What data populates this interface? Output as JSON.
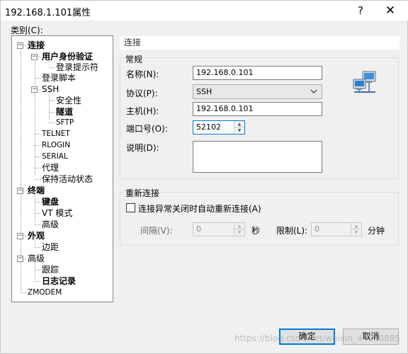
{
  "window": {
    "title": "192.168.1.101属性",
    "help_glyph": "?",
    "close_glyph": "✕"
  },
  "category_label": "类别(C):",
  "tree": [
    {
      "label": "连接",
      "bold": true,
      "toggle": "−"
    },
    {
      "label": "用户身份验证",
      "bold": true,
      "toggle": "−"
    },
    {
      "label": "登录提示符"
    },
    {
      "label": "登录脚本"
    },
    {
      "label": "SSH",
      "toggle": "−"
    },
    {
      "label": "安全性"
    },
    {
      "label": "隧道",
      "bold": true
    },
    {
      "label": "SFTP"
    },
    {
      "label": "TELNET"
    },
    {
      "label": "RLOGIN"
    },
    {
      "label": "SERIAL"
    },
    {
      "label": "代理"
    },
    {
      "label": "保持活动状态"
    },
    {
      "label": "终端",
      "bold": true,
      "toggle": "−"
    },
    {
      "label": "键盘",
      "bold": true
    },
    {
      "label": "VT 模式"
    },
    {
      "label": "高级"
    },
    {
      "label": "外观",
      "bold": true,
      "toggle": "−"
    },
    {
      "label": "边距"
    },
    {
      "label": "高级",
      "toggle": "−"
    },
    {
      "label": "跟踪"
    },
    {
      "label": "日志记录",
      "bold": true
    },
    {
      "label": "ZMODEM"
    }
  ],
  "panel_header": "连接",
  "general": {
    "title": "常规",
    "name_label": "名称(N):",
    "name_value": "192.168.0.101",
    "protocol_label": "协议(P):",
    "protocol_value": "SSH",
    "host_label": "主机(H):",
    "host_value": "192.168.0.101",
    "port_label": "端口号(O):",
    "port_value": "52102",
    "desc_label": "说明(D):",
    "desc_value": ""
  },
  "reconnect": {
    "title": "重新连接",
    "checkbox_label": "连接异常关闭时自动重新连接(A)",
    "interval_label": "间隔(V):",
    "interval_value": "0",
    "interval_unit": "秒",
    "limit_label": "限制(L):",
    "limit_value": "0",
    "limit_unit": "分钟"
  },
  "buttons": {
    "ok": "确定",
    "cancel": "取消"
  },
  "watermark": "https://blog.csdn.net/weixin_44850885"
}
